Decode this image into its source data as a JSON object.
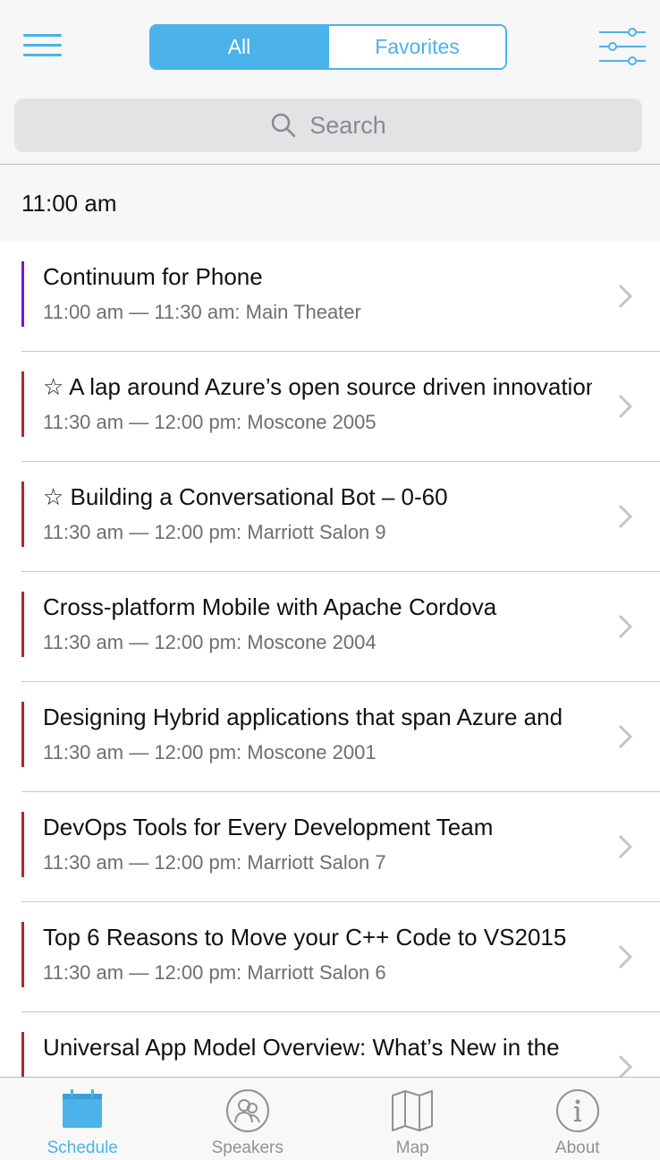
{
  "header": {
    "segments": [
      {
        "label": "All",
        "active": true
      },
      {
        "label": "Favorites",
        "active": false
      }
    ],
    "search_placeholder": "Search"
  },
  "section": {
    "title": "11:00 am"
  },
  "sessions": [
    {
      "title": "Continuum for Phone",
      "subtitle": "11:00 am — 11:30 am: Main Theater",
      "track_color": "#6a1bd6"
    },
    {
      "title": "☆ A lap around Azure’s open source driven innovation",
      "subtitle": "11:30 am — 12:00 pm: Moscone 2005",
      "track_color": "#b5252b"
    },
    {
      "title": "☆ Building a Conversational Bot – 0-60",
      "subtitle": "11:30 am — 12:00 pm: Marriott Salon 9",
      "track_color": "#b5252b"
    },
    {
      "title": "Cross-platform Mobile with Apache Cordova",
      "subtitle": "11:30 am — 12:00 pm: Moscone 2004",
      "track_color": "#b5252b"
    },
    {
      "title": "Designing Hybrid applications that span Azure and",
      "subtitle": "11:30 am — 12:00 pm: Moscone 2001",
      "track_color": "#b5252b"
    },
    {
      "title": "DevOps Tools for Every Development Team",
      "subtitle": "11:30 am — 12:00 pm: Marriott Salon 7",
      "track_color": "#b5252b"
    },
    {
      "title": "Top 6 Reasons to Move your C++ Code to VS2015",
      "subtitle": "11:30 am — 12:00 pm: Marriott Salon 6",
      "track_color": "#b5252b"
    },
    {
      "title": "Universal App Model Overview: What’s New in the",
      "subtitle": "",
      "track_color": "#b5252b"
    }
  ],
  "tabs": [
    {
      "label": "Schedule",
      "icon": "calendar-icon",
      "active": true
    },
    {
      "label": "Speakers",
      "icon": "people-icon",
      "active": false
    },
    {
      "label": "Map",
      "icon": "map-icon",
      "active": false
    },
    {
      "label": "About",
      "icon": "info-icon",
      "active": false
    }
  ],
  "colors": {
    "accent": "#4bb2ea",
    "track_purple": "#6a1bd6",
    "track_red": "#b5252b"
  }
}
